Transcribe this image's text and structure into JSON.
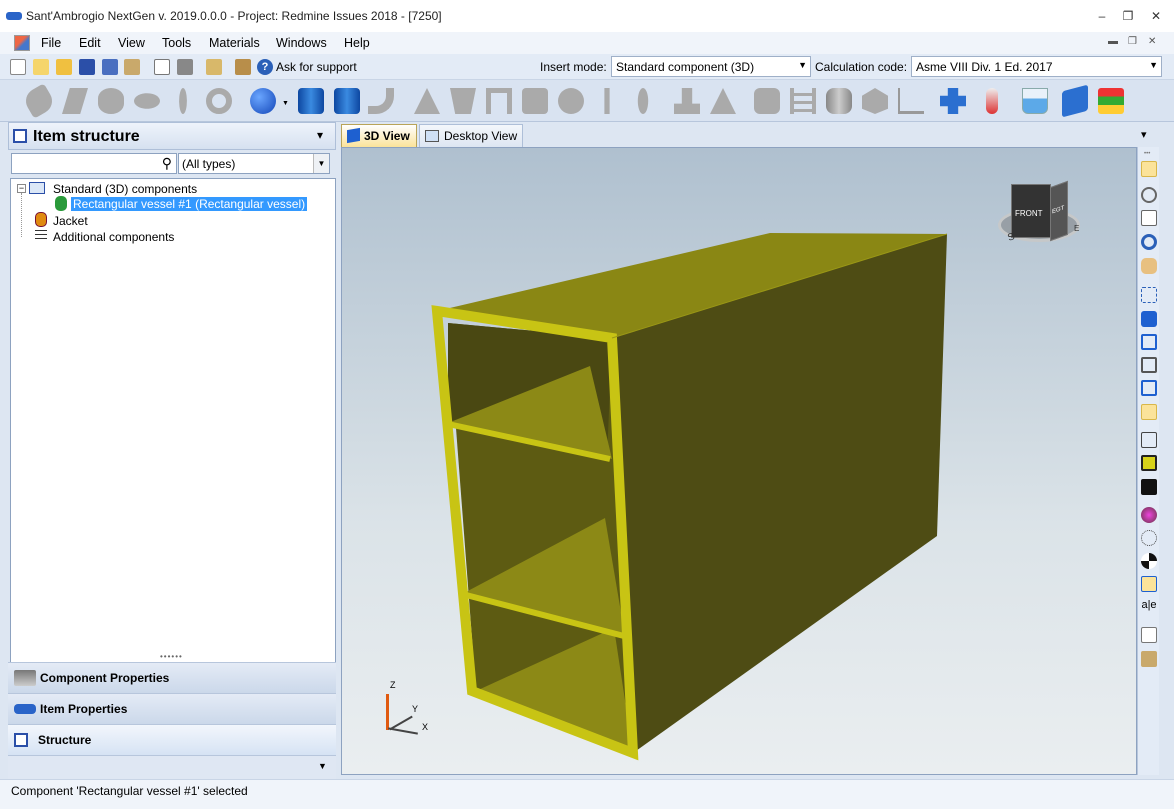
{
  "window": {
    "title": "Sant'Ambrogio NextGen v. 2019.0.0.0 - Project: Redmine Issues 2018 - [7250]",
    "min": "–",
    "restore": "❐",
    "close": "✕"
  },
  "menu": {
    "file": "File",
    "edit": "Edit",
    "view": "View",
    "tools": "Tools",
    "materials": "Materials",
    "windows": "Windows",
    "help": "Help"
  },
  "toolbar": {
    "support": "Ask for support",
    "insert_mode_label": "Insert mode:",
    "insert_mode_value": "Standard component (3D)",
    "calc_label": "Calculation code:",
    "calc_value": "Asme VIII Div. 1 Ed. 2017"
  },
  "left": {
    "title": "Item structure",
    "filter_placeholder": "",
    "type_value": "(All types)",
    "tree": [
      "Standard (3D) components",
      "Rectangular vessel #1 (Rectangular vessel)",
      "Jacket",
      "Additional components"
    ]
  },
  "bottom_tabs": [
    "Component Properties",
    "Item Properties",
    "Structure"
  ],
  "tabs": {
    "view3d": "3D View",
    "desktop": "Desktop View"
  },
  "cube": {
    "front": "FRONT",
    "side": "EGT",
    "s": "S",
    "e": "E"
  },
  "axes": {
    "z": "Z",
    "y": "Y",
    "x": "X"
  },
  "status": "Component 'Rectangular vessel #1' selected",
  "colors": {
    "vessel_rim": "#c8c414",
    "vessel_front": "#7e7c12",
    "vessel_side": "#4e4c14",
    "vessel_top": "#8a8714",
    "selection": "#3399ff"
  }
}
